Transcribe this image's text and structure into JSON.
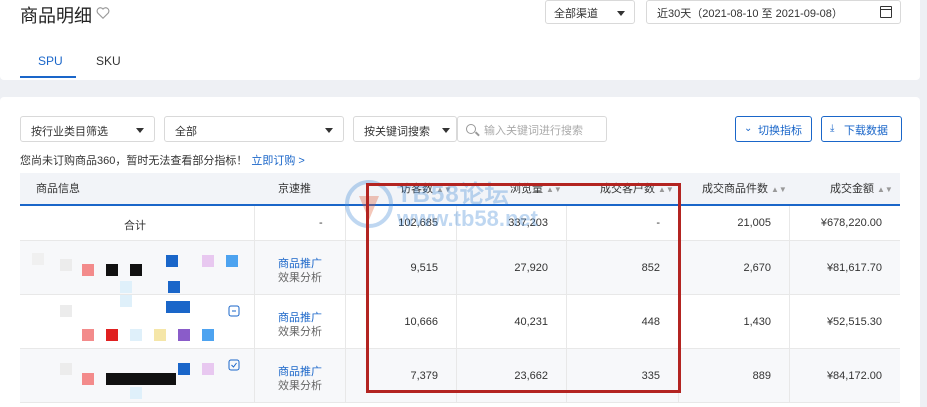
{
  "page": {
    "title": "商品明细",
    "channel_select": "全部渠道",
    "date_range": "近30天（2021-08-10 至 2021-09-08）",
    "tabs": [
      {
        "label": "SPU",
        "active": true
      },
      {
        "label": "SKU",
        "active": false
      }
    ]
  },
  "filters": {
    "category_select": "按行业类目筛选",
    "scope_select": "全部",
    "keyword_mode": "按关键词搜索",
    "search_placeholder": "输入关键词进行搜索",
    "switch_metrics": "切换指标",
    "download": "下载数据"
  },
  "notice": {
    "text": "您尚未订购商品360，暂时无法查看部分指标！",
    "link": "立即订购 >"
  },
  "table": {
    "headers": [
      "商品信息",
      "京速推",
      "访客数",
      "浏览量",
      "成交客户数",
      "成交商品件数",
      "成交金额"
    ],
    "total": {
      "label": "合计",
      "jingsutui": "-",
      "visitors": "102,685",
      "pageviews": "337,203",
      "buyers": "-",
      "items": "21,005",
      "amount": "¥678,220.00"
    },
    "rows": [
      {
        "promo": "商品推广",
        "analysis": "效果分析",
        "visitors": "9,515",
        "pageviews": "27,920",
        "buyers": "852",
        "items": "2,670",
        "amount": "¥81,617.70"
      },
      {
        "promo": "商品推广",
        "analysis": "效果分析",
        "visitors": "10,666",
        "pageviews": "40,231",
        "buyers": "448",
        "items": "1,430",
        "amount": "¥52,515.30"
      },
      {
        "promo": "商品推广",
        "analysis": "效果分析",
        "visitors": "7,379",
        "pageviews": "23,662",
        "buyers": "335",
        "items": "889",
        "amount": "¥84,172.00"
      }
    ]
  },
  "watermark": {
    "line1": "TB58论坛",
    "line2": "www.tb58.net"
  },
  "colors": {
    "accent": "#1a66c9",
    "highlight_box": "#b32421"
  }
}
